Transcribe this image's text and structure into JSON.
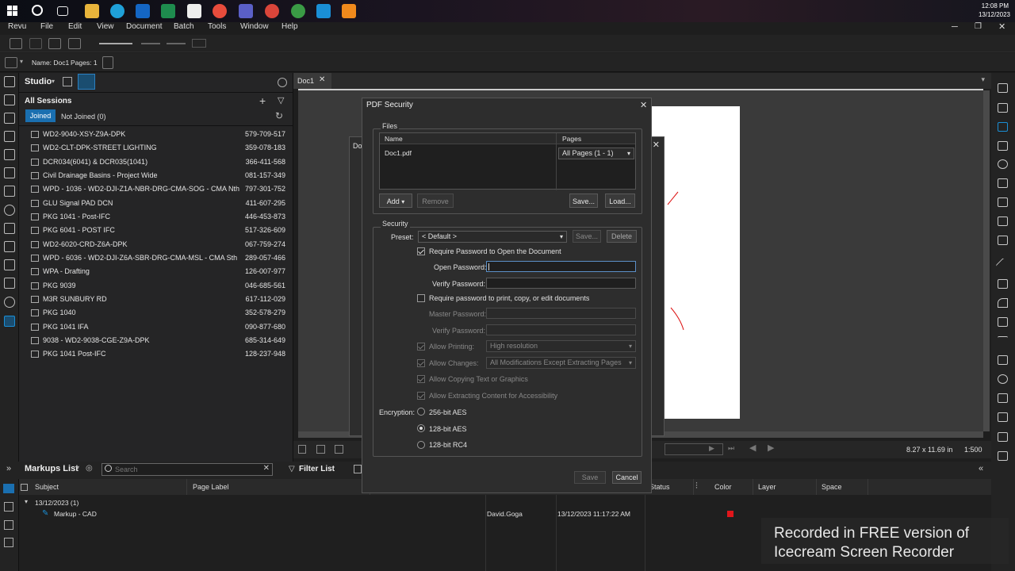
{
  "taskbar": {
    "time": "12:08 PM",
    "date": "13/12/2023"
  },
  "menubar": {
    "items": [
      "Revu",
      "File",
      "Edit",
      "View",
      "Document",
      "Batch",
      "Tools",
      "Window",
      "Help"
    ]
  },
  "toolbar2": {
    "name_label": "Name: Doc1",
    "pages_label": "Pages: 1"
  },
  "studio": {
    "title": "Studio",
    "sessions_header": "All Sessions",
    "tabs": [
      "Joined",
      "Not Joined (0)"
    ],
    "sessions": [
      {
        "name": "WD2-9040-XSY-Z9A-DPK",
        "id": "579-709-517"
      },
      {
        "name": "WD2-CLT-DPK-STREET LIGHTING",
        "id": "359-078-183"
      },
      {
        "name": "DCR034(6041) & DCR035(1041)",
        "id": "366-411-568"
      },
      {
        "name": "Civil Drainage Basins - Project Wide",
        "id": "081-157-349"
      },
      {
        "name": "WPD - 1036 - WD2-DJI-Z1A-NBR-DRG-CMA-SOG - CMA Nth",
        "id": "797-301-752"
      },
      {
        "name": "GLU Signal PAD DCN",
        "id": "411-607-295"
      },
      {
        "name": "PKG 1041 - Post-IFC",
        "id": "446-453-873"
      },
      {
        "name": "PKG 6041 - POST IFC",
        "id": "517-326-609"
      },
      {
        "name": "WD2-6020-CRD-Z6A-DPK",
        "id": "067-759-274"
      },
      {
        "name": "WPD - 6036 - WD2-DJI-Z6A-SBR-DRG-CMA-MSL - CMA Sth",
        "id": "289-057-466"
      },
      {
        "name": "WPA - Drafting",
        "id": "126-007-977"
      },
      {
        "name": "PKG 9039",
        "id": "046-685-561"
      },
      {
        "name": "M3R SUNBURY RD",
        "id": "617-112-029"
      },
      {
        "name": "PKG 1040",
        "id": "352-578-279"
      },
      {
        "name": "PKG 1041 IFA",
        "id": "090-877-680"
      },
      {
        "name": "9038 - WD2-9038-CGE-Z9A-DPK",
        "id": "685-314-649"
      },
      {
        "name": "PKG 1041 Post-IFC",
        "id": "128-237-948"
      }
    ]
  },
  "document": {
    "tab": "Doc1",
    "bg_dialog_tab": "Doc"
  },
  "statusbar": {
    "size": "8.27 x 11.69 in",
    "scale": "1:500"
  },
  "markups": {
    "title": "Markups List",
    "search_placeholder": "Search",
    "filter_label": "Filter List",
    "columns": [
      "Subject",
      "Page Label",
      "Status",
      "Color",
      "Layer",
      "Space"
    ],
    "group": "13/12/2023 (1)",
    "row": {
      "subject": "Markup - CAD",
      "author": "David.Goga",
      "date": "13/12/2023 11:17:22 AM",
      "color": "#e0161b"
    }
  },
  "dialog": {
    "title": "PDF Security",
    "files_label": "Files",
    "col_name": "Name",
    "col_pages": "Pages",
    "file": {
      "name": "Doc1.pdf",
      "pages": "All Pages (1 - 1)"
    },
    "add": "Add",
    "remove": "Remove",
    "save_files": "Save...",
    "load": "Load...",
    "security_label": "Security",
    "preset_label": "Preset:",
    "preset_value": "< Default >",
    "preset_save": "Save...",
    "preset_delete": "Delete",
    "require_open": "Require Password to Open the Document",
    "open_pw_label": "Open Password:",
    "verify_pw_label": "Verify Password:",
    "require_perm": "Require password to print, copy, or edit documents",
    "master_pw_label": "Master Password:",
    "verify_pw2_label": "Verify Password:",
    "allow_printing": "Allow Printing:",
    "printing_value": "High resolution",
    "allow_changes": "Allow Changes:",
    "changes_value": "All Modifications Except Extracting Pages",
    "allow_copying": "Allow Copying Text or Graphics",
    "allow_extract": "Allow Extracting Content for Accessibility",
    "encryption_label": "Encryption:",
    "enc_options": [
      "256-bit AES",
      "128-bit AES",
      "128-bit RC4"
    ],
    "enc_selected": "128-bit AES",
    "save": "Save",
    "cancel": "Cancel"
  },
  "watermark": {
    "line1": "Recorded in FREE version of",
    "line2": "Icecream Screen Recorder"
  }
}
